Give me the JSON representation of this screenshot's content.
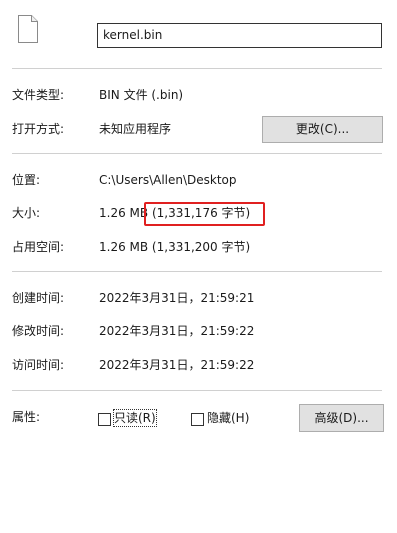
{
  "file": {
    "icon": "blank-file-icon",
    "name": "kernel.bin"
  },
  "type_row": {
    "label": "文件类型:",
    "value": "BIN 文件 (.bin)"
  },
  "opens_with_row": {
    "label": "打开方式:",
    "value": "未知应用程序",
    "change_button": "更改(C)..."
  },
  "location_row": {
    "label": "位置:",
    "value": "C:\\Users\\Allen\\Desktop"
  },
  "size_row": {
    "label": "大小:",
    "value_prefix": "1.26 MB",
    "value_bytes": "(1,331,176 字节)"
  },
  "size_on_disk_row": {
    "label": "占用空间:",
    "value": "1.26 MB (1,331,200 字节)"
  },
  "created_row": {
    "label": "创建时间:",
    "value": "2022年3月31日，21:59:21"
  },
  "modified_row": {
    "label": "修改时间:",
    "value": "2022年3月31日，21:59:22"
  },
  "accessed_row": {
    "label": "访问时间:",
    "value": "2022年3月31日，21:59:22"
  },
  "attributes": {
    "label": "属性:",
    "readonly_label": "只读(R)",
    "readonly_checked": false,
    "hidden_label": "隐藏(H)",
    "hidden_checked": false,
    "advanced_button": "高级(D)..."
  },
  "colors": {
    "highlight": "#e02020",
    "button_bg": "#e1e1e1"
  }
}
